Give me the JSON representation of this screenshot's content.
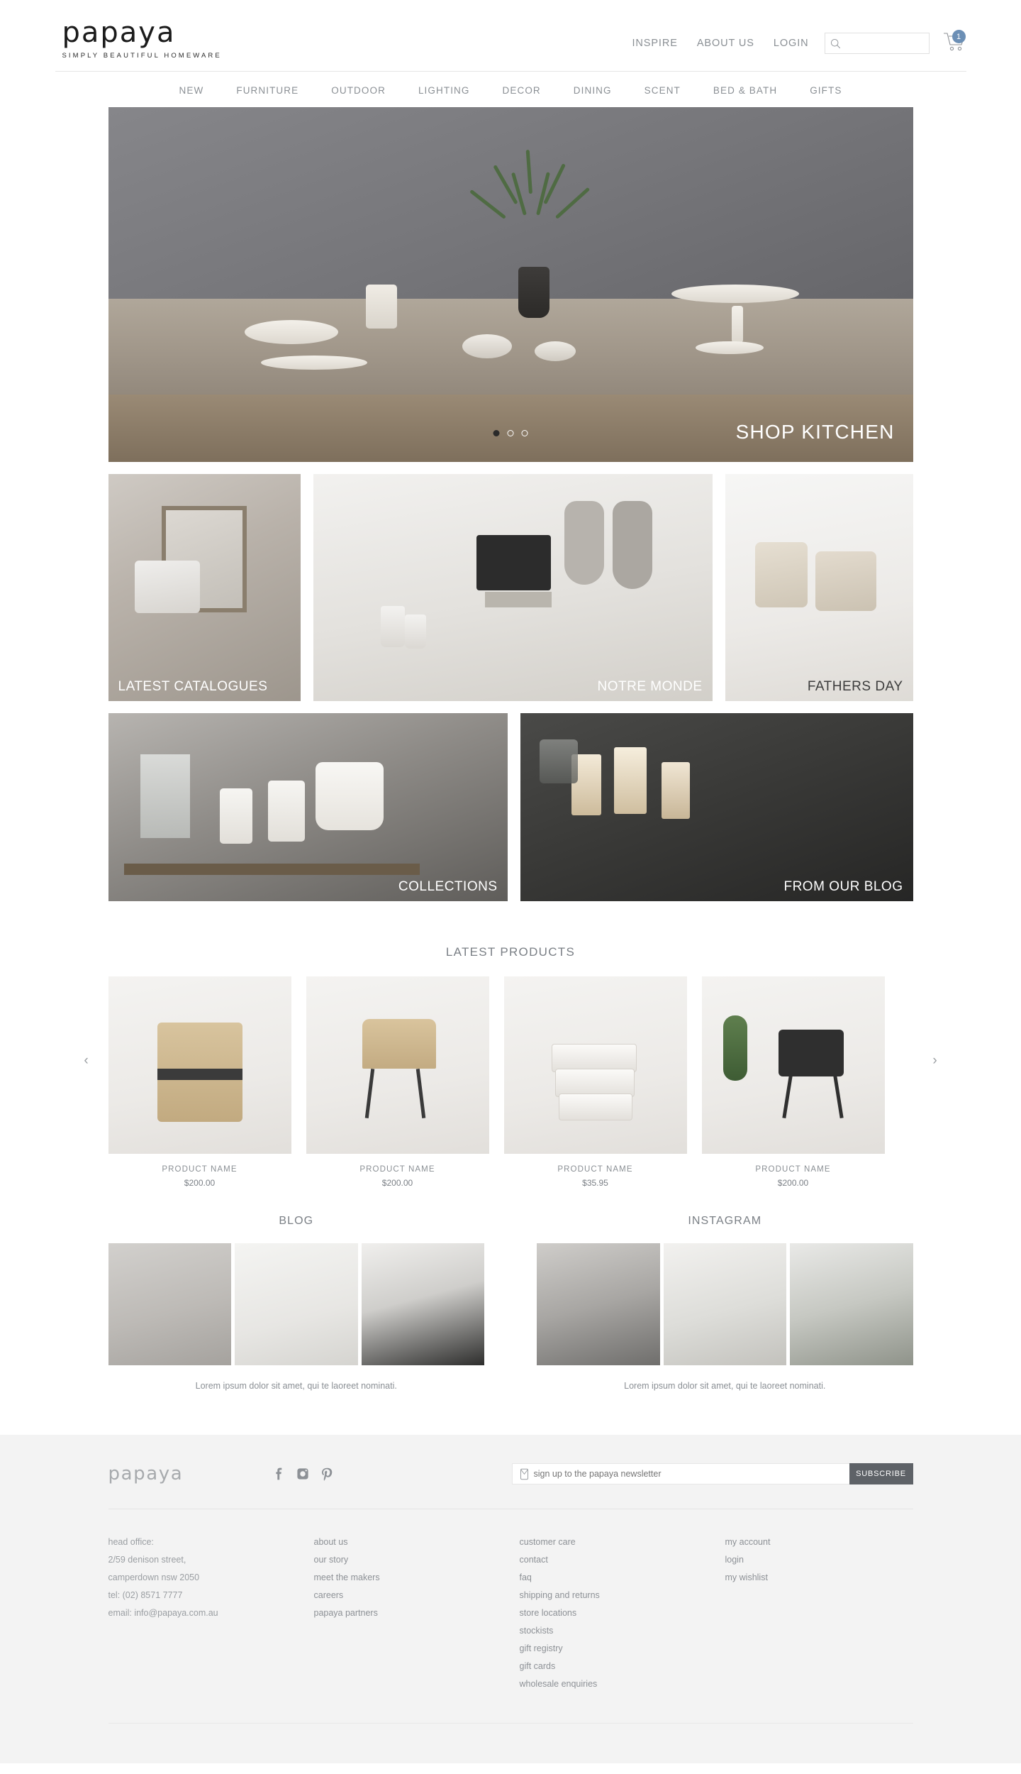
{
  "header": {
    "logo_text": "papaya",
    "tagline": "SIMPLY BEAUTIFUL HOMEWARE",
    "top_links": [
      {
        "label": "INSPIRE"
      },
      {
        "label": "ABOUT US"
      },
      {
        "label": "LOGIN"
      }
    ],
    "search": {
      "value": "",
      "placeholder": ""
    },
    "cart": {
      "count": "1"
    }
  },
  "nav": {
    "items": [
      {
        "label": "NEW"
      },
      {
        "label": "FURNITURE"
      },
      {
        "label": "OUTDOOR"
      },
      {
        "label": "LIGHTING"
      },
      {
        "label": "DECOR"
      },
      {
        "label": "DINING"
      },
      {
        "label": "SCENT"
      },
      {
        "label": "BED & BATH"
      },
      {
        "label": "GIFTS"
      }
    ]
  },
  "hero": {
    "label": "SHOP KITCHEN",
    "prev_glyph": "‹",
    "next_glyph": "›",
    "dots": 3,
    "active_dot": 0
  },
  "tiles_row1": [
    {
      "label": "LATEST CATALOGUES",
      "align": "left"
    },
    {
      "label": "NOTRE MONDE",
      "align": "right"
    },
    {
      "label": "FATHERS DAY",
      "align": "right"
    }
  ],
  "tiles_row2": [
    {
      "label": "COLLECTIONS",
      "align": "right"
    },
    {
      "label": "FROM OUR BLOG",
      "align": "right"
    }
  ],
  "latest_products": {
    "title": "LATEST PRODUCTS",
    "prev_glyph": "‹",
    "next_glyph": "›",
    "items": [
      {
        "name": "PRODUCT NAME",
        "price": "$200.00"
      },
      {
        "name": "PRODUCT NAME",
        "price": "$200.00"
      },
      {
        "name": "PRODUCT NAME",
        "price": "$35.95"
      },
      {
        "name": "PRODUCT NAME",
        "price": "$200.00"
      }
    ]
  },
  "feeds": [
    {
      "title": "BLOG",
      "caption": "Lorem ipsum dolor sit amet, qui te laoreet nominati."
    },
    {
      "title": "INSTAGRAM",
      "caption": "Lorem ipsum dolor sit amet, qui te laoreet nominati."
    }
  ],
  "footer": {
    "logo_text": "papaya",
    "socials": [
      {
        "name": "facebook-icon"
      },
      {
        "name": "instagram-icon"
      },
      {
        "name": "pinterest-icon"
      }
    ],
    "newsletter": {
      "value": "",
      "placeholder": "sign up to the papaya newsletter",
      "button_label": "SUBSCRIBE"
    },
    "contact": {
      "lines": [
        "head office:",
        "2/59 denison street,",
        "camperdown nsw 2050",
        "tel: (02) 8571 7777",
        "email: info@papaya.com.au"
      ]
    },
    "col2": [
      {
        "label": "about us"
      },
      {
        "label": "our story"
      },
      {
        "label": "meet the makers"
      },
      {
        "label": "careers"
      },
      {
        "label": "papaya partners"
      }
    ],
    "col3": [
      {
        "label": "customer care"
      },
      {
        "label": "contact"
      },
      {
        "label": "faq"
      },
      {
        "label": "shipping and returns"
      },
      {
        "label": "store locations"
      },
      {
        "label": "stockists"
      },
      {
        "label": "gift registry"
      },
      {
        "label": "gift cards"
      },
      {
        "label": "wholesale enquiries"
      }
    ],
    "col4": [
      {
        "label": "my account"
      },
      {
        "label": "login"
      },
      {
        "label": "my wishlist"
      }
    ]
  },
  "colors": {
    "cart_badge": "#6c8fb5",
    "subscribe_bg": "#5e6267",
    "footer_bg": "#f3f3f3",
    "text_muted": "#8a8f94"
  }
}
